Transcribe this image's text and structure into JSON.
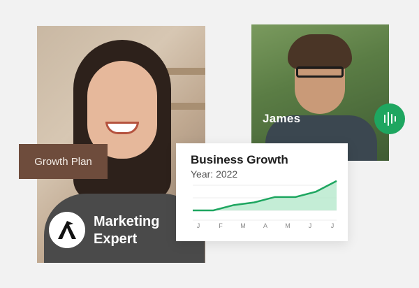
{
  "tags": {
    "growth_plan": "Growth Plan"
  },
  "people": {
    "woman_title_line1": "Marketing",
    "woman_title_line2": "Expert",
    "man_name": "James"
  },
  "card": {
    "title": "Business Growth",
    "subtitle": "Year: 2022"
  },
  "chart_data": {
    "type": "area",
    "title": "Business Growth",
    "subtitle": "Year: 2022",
    "categories": [
      "J",
      "F",
      "M",
      "A",
      "M",
      "J",
      "J"
    ],
    "x": [
      0,
      1,
      2,
      3,
      4,
      5,
      6,
      7
    ],
    "values": [
      0,
      0,
      2,
      3,
      5,
      5,
      7,
      11
    ],
    "ylim": [
      0,
      12
    ],
    "grid": true,
    "legend": "none",
    "line_color": "#1ea660",
    "fill_color": "#b5e8cc"
  },
  "colors": {
    "accent_green": "#1ea660",
    "tag_brown": "#6e4c3c",
    "background": "#f2f2f2"
  },
  "icons": {
    "logo": "mountain-flag-logo",
    "audio": "audio-wave-icon"
  }
}
